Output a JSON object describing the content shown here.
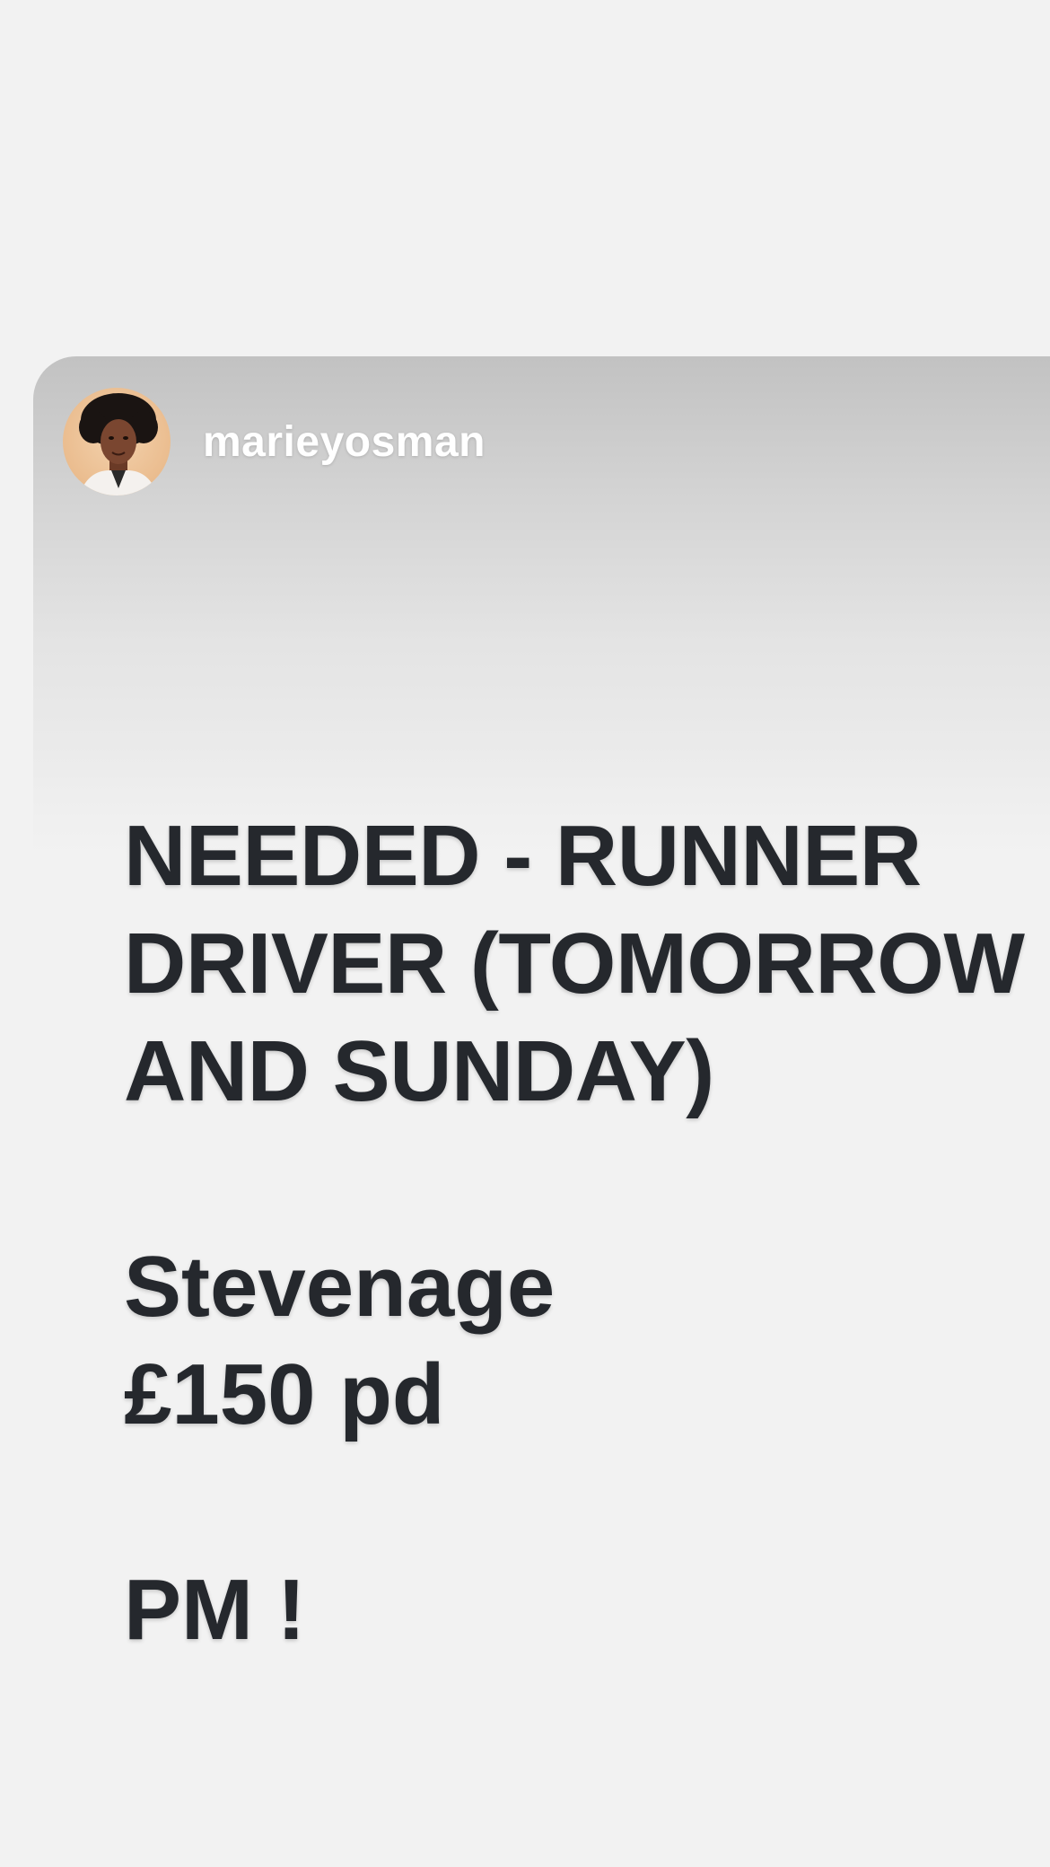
{
  "story": {
    "author": {
      "username": "marieyosman",
      "avatar_icon": "profile-photo-avatar"
    },
    "headline_lines": [
      "NEEDED - RUNNER",
      "DRIVER (TOMORROW",
      "AND SUNDAY)"
    ],
    "location": "Stevenage",
    "pay": "£150 pd",
    "call_to_action": "PM !"
  },
  "colors": {
    "page_background": "#f2f2f2",
    "header_gradient_top": "#c2c2c2",
    "text": "#25282d",
    "username": "#ffffff"
  }
}
